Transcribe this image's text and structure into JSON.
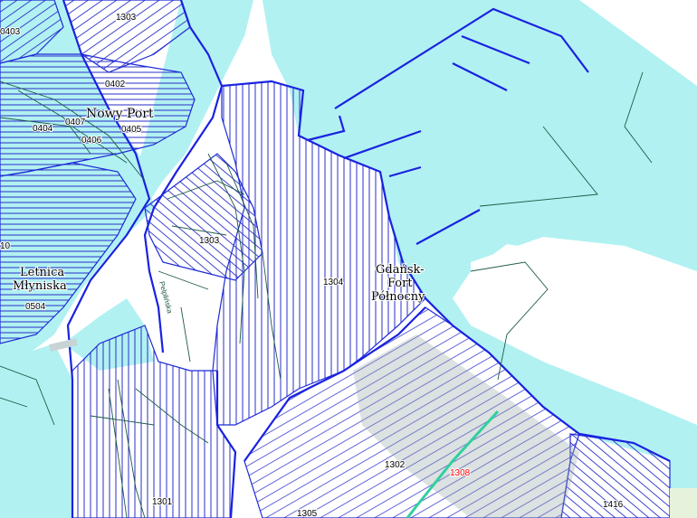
{
  "map": {
    "colors": {
      "water": "#b1f1f2",
      "land": "#ffffff",
      "boundary": "#1a22e0",
      "hatch": "#2a2fc8",
      "detail": "#1f5a45",
      "highlight_label": "#ff0000",
      "green_land": "#e6f2dc"
    },
    "district_labels": [
      {
        "id": "nowy-port",
        "text": "Nowy Port"
      },
      {
        "id": "letnica-mlyniska",
        "line1": "Letnica",
        "line2": "Młyniska"
      },
      {
        "id": "gdansk-fort-polnocny",
        "line1": "Gdańsk-",
        "line2": "Fort",
        "line3": "Północny"
      }
    ],
    "zone_codes": [
      {
        "id": "1303-top",
        "text": "1303"
      },
      {
        "id": "0403",
        "text": "0403"
      },
      {
        "id": "0402",
        "text": "0402"
      },
      {
        "id": "0404",
        "text": "0404"
      },
      {
        "id": "0407",
        "text": "0407"
      },
      {
        "id": "0405",
        "text": "0405"
      },
      {
        "id": "0406",
        "text": "0406"
      },
      {
        "id": "1303",
        "text": "1303"
      },
      {
        "id": "1304",
        "text": "1304"
      },
      {
        "id": "0504",
        "text": "0504"
      },
      {
        "id": "10-edge",
        "text": "10"
      },
      {
        "id": "1302",
        "text": "1302"
      },
      {
        "id": "1308",
        "text": "1308"
      },
      {
        "id": "1301",
        "text": "1301"
      },
      {
        "id": "1305",
        "text": "1305"
      },
      {
        "id": "1416",
        "text": "1416"
      }
    ],
    "street_label": "Pelplińska"
  }
}
